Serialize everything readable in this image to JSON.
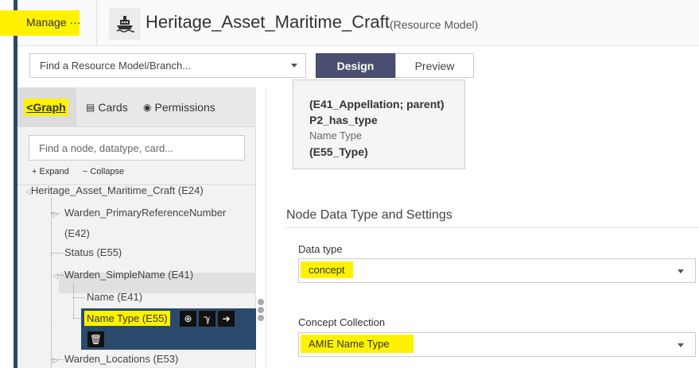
{
  "header": {
    "manage_label": "Manage ···",
    "model_title": "Heritage_Asset_Maritime_Craft",
    "model_subtitle": "(Resource Model)",
    "model_icon": "ship-icon"
  },
  "toolbar": {
    "branch_placeholder": "Find a Resource Model/Branch...",
    "design_label": "Design",
    "preview_label": "Preview"
  },
  "left_panel": {
    "tabs": [
      {
        "label": "Graph",
        "icon": "share-icon"
      },
      {
        "label": "Cards",
        "icon": "card-icon"
      },
      {
        "label": "Permissions",
        "icon": "lock-icon"
      }
    ],
    "search_placeholder": "Find a node, datatype, card...",
    "expand_label": "+ Expand",
    "collapse_label": "− Collapse",
    "tree": {
      "root": "Heritage_Asset_Maritime_Craft (E24)",
      "n1a": "Warden_PrimaryReferenceNumber",
      "n1b": "(E42)",
      "n2": "Status (E55)",
      "n3": "Warden_SimpleName (E41)",
      "n4": "Name (E41)",
      "n5": "Name Type (E55)",
      "n6": "Warden_Locations (E53)"
    }
  },
  "info_card": {
    "line1": "(E41_Appellation; parent)",
    "line2": "P2_has_type",
    "line3": "Name Type",
    "line4": "(E55_Type)"
  },
  "node_settings": {
    "section_title": "Node Data Type and Settings",
    "datatype_label": "Data type",
    "datatype_value": "concept",
    "collection_label": "Concept Collection",
    "collection_value": "AMIE Name Type"
  },
  "colors": {
    "highlight": "#fff200",
    "accent": "#4a4f72",
    "active_row": "#2c4a6b"
  }
}
